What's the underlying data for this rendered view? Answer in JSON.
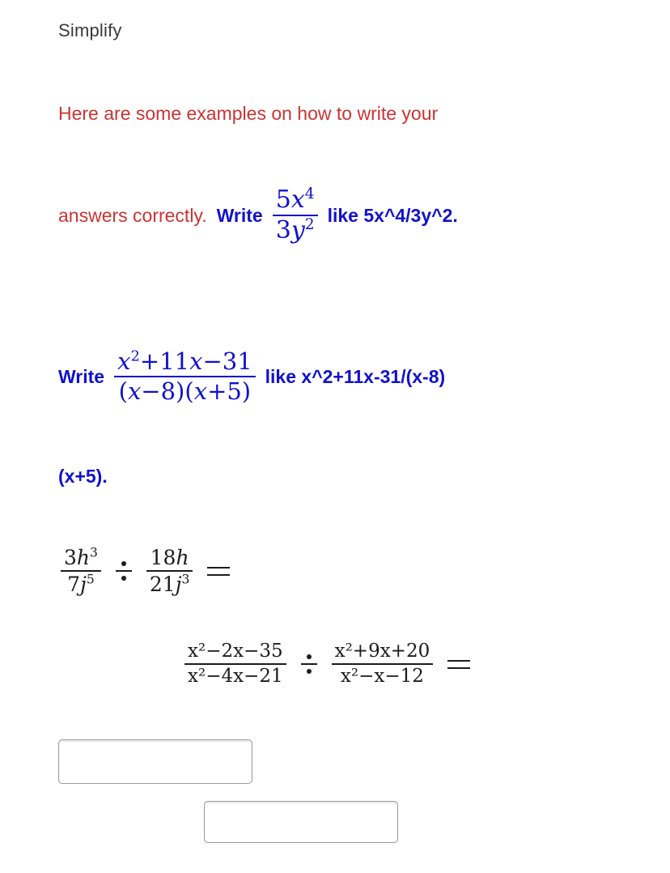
{
  "page": {
    "title": "Simplify",
    "colors": {
      "red": "#cc3333",
      "blue": "#1111cc",
      "title_gray": "#3a3a3a",
      "math_black": "#1c1c1c",
      "input_border": "#9a9a9a",
      "background": "#ffffff"
    }
  },
  "instructions": {
    "line1_red": "Here are some examples on how to write your",
    "line2_red": "answers correctly.",
    "write_label_1": "Write",
    "like_label_1": "like 5x^4/3y^2.",
    "write_label_2": "Write",
    "like_label_2": "like x^2+11x-31/(x-8)",
    "line3_blue": "(x+5)."
  },
  "example_1": {
    "fraction": {
      "numerator": {
        "coefficient": "5",
        "variable": "x",
        "exponent": "4"
      },
      "denominator": {
        "coefficient": "3",
        "variable": "y",
        "exponent": "2"
      }
    },
    "plain_text": "5x^4/3y^2"
  },
  "example_2": {
    "fraction": {
      "numerator": {
        "var": "x",
        "exp": "2",
        "rest": "+11",
        "var2": "x",
        "rest2": "−31"
      },
      "denominator": {
        "factor1_open": "(",
        "f1_var": "x",
        "f1_rest": "−8)",
        "factor2_open": "(",
        "f2_var": "x",
        "f2_rest": "+5)"
      }
    },
    "plain_text": "x^2+11x-31/(x-8)(x+5)"
  },
  "problems": [
    {
      "id": "problem-1",
      "left_fraction": {
        "numerator": {
          "coefficient": "3",
          "variable": "h",
          "exponent": "3"
        },
        "denominator": {
          "coefficient": "7",
          "variable": "j",
          "exponent": "5"
        }
      },
      "operator": "÷",
      "right_fraction": {
        "numerator": {
          "coefficient": "18",
          "variable": "h",
          "exponent": ""
        },
        "denominator": {
          "coefficient": "21",
          "variable": "j",
          "exponent": "3"
        }
      },
      "equals": "=",
      "plain_text": "3h^3/7j^5 ÷ 18h/21j^3 ="
    },
    {
      "id": "problem-2",
      "left_fraction": {
        "numerator_text": "x²−2x−35",
        "denominator_text": "x²−4x−21"
      },
      "operator": "÷",
      "right_fraction": {
        "numerator_text": "x²+9x+20",
        "denominator_text": "x²−x−12"
      },
      "equals": "=",
      "plain_text": "(x^2-2x-35)/(x^2-4x-21) ÷ (x^2+9x+20)/(x^2-x-12) ="
    }
  ],
  "answers": {
    "box1": {
      "value": "",
      "placeholder": ""
    },
    "box2": {
      "value": "",
      "placeholder": ""
    }
  }
}
